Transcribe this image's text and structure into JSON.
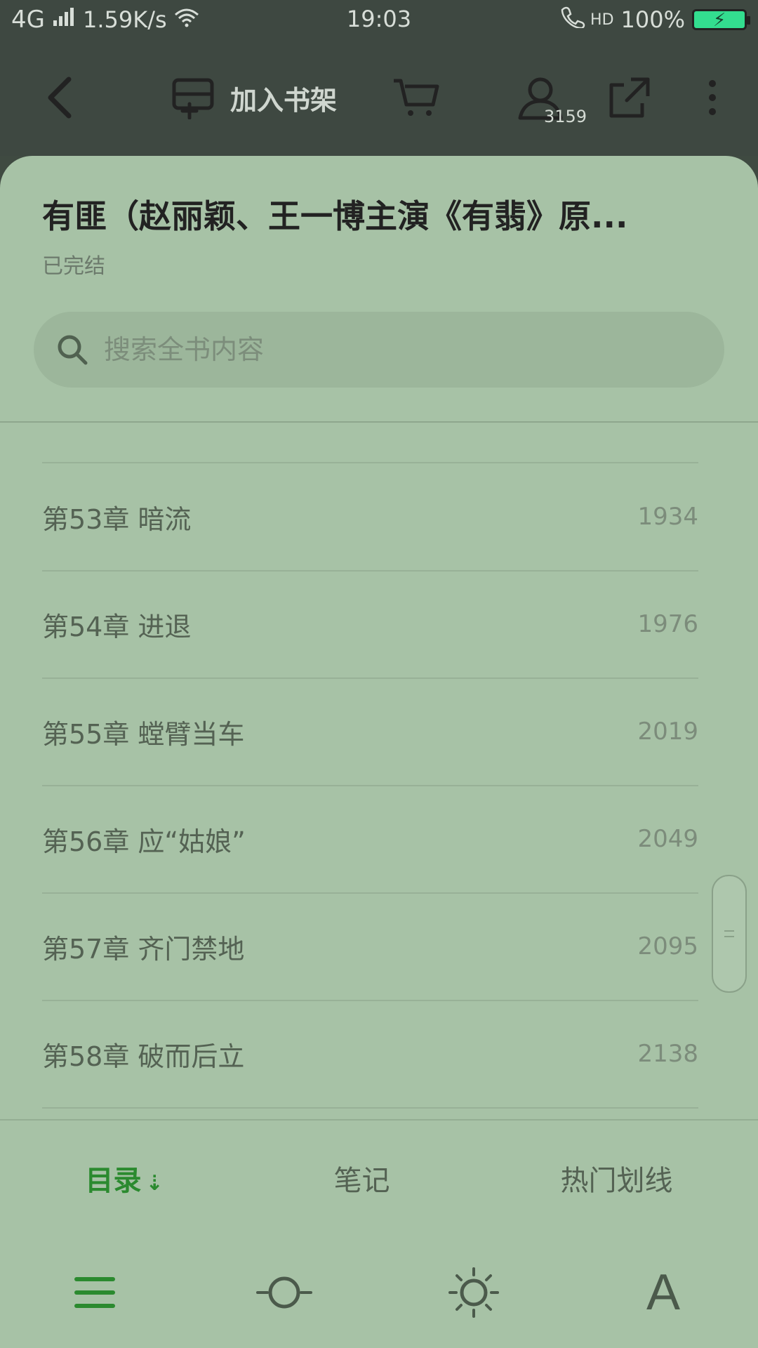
{
  "status_bar": {
    "network": "4G",
    "speed": "1.59K/s",
    "time": "19:03",
    "hd": "HD",
    "battery": "100%"
  },
  "toolbar": {
    "add_shelf_label": "加入书架",
    "user_count": "3159"
  },
  "book": {
    "title": "有匪（赵丽颖、王一博主演《有翡》原...",
    "status": "已完结"
  },
  "search": {
    "placeholder": "搜索全书内容"
  },
  "chapters": [
    {
      "title": "第53章 暗流",
      "count": "1934"
    },
    {
      "title": "第54章 进退",
      "count": "1976"
    },
    {
      "title": "第55章 螳臂当车",
      "count": "2019"
    },
    {
      "title": "第56章 应“姑娘”",
      "count": "2049"
    },
    {
      "title": "第57章 齐门禁地",
      "count": "2095"
    },
    {
      "title": "第58章 破而后立",
      "count": "2138"
    }
  ],
  "tabs": {
    "catalog": "目录",
    "notes": "笔记",
    "hot_lines": "热门划线"
  },
  "bottom": {
    "font_label": "A"
  },
  "colors": {
    "accent": "#2b8a2f",
    "sheet_bg": "#a7c2a6",
    "overlay": "#3e4841"
  }
}
